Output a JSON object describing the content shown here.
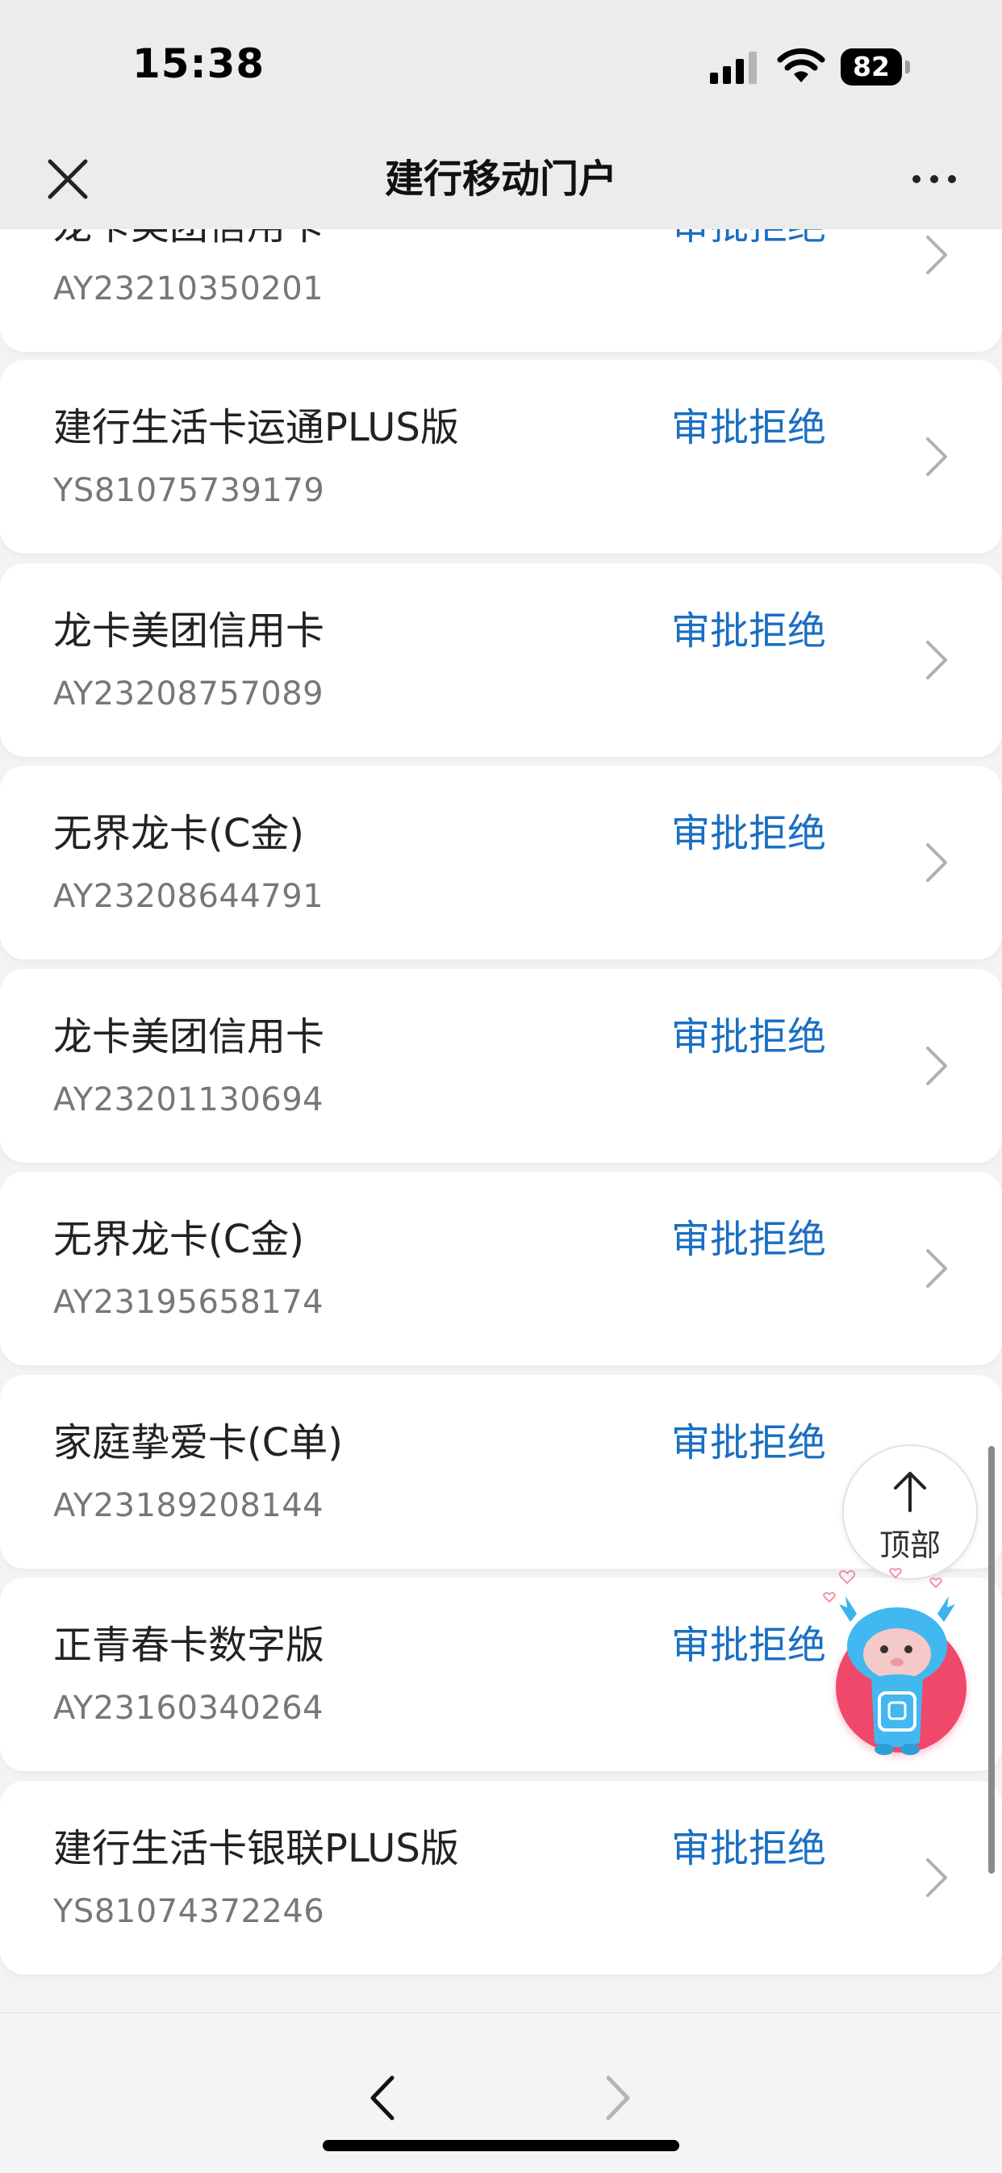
{
  "status_bar": {
    "time": "15:38",
    "battery": "82"
  },
  "nav": {
    "title": "建行移动门户"
  },
  "applications": [
    {
      "name": "龙卡美团信用卡",
      "number": "AY23210350201",
      "status": "审批拒绝"
    },
    {
      "name": "建行生活卡运通PLUS版",
      "number": "YS81075739179",
      "status": "审批拒绝"
    },
    {
      "name": "龙卡美团信用卡",
      "number": "AY23208757089",
      "status": "审批拒绝"
    },
    {
      "name": "无界龙卡(C金)",
      "number": "AY23208644791",
      "status": "审批拒绝"
    },
    {
      "name": "龙卡美团信用卡",
      "number": "AY23201130694",
      "status": "审批拒绝"
    },
    {
      "name": "无界龙卡(C金)",
      "number": "AY23195658174",
      "status": "审批拒绝"
    },
    {
      "name": "家庭挚爱卡(C单)",
      "number": "AY23189208144",
      "status": "审批拒绝"
    },
    {
      "name": "正青春卡数字版",
      "number": "AY23160340264",
      "status": "审批拒绝"
    },
    {
      "name": "建行生活卡银联PLUS版",
      "number": "YS81074372246",
      "status": "审批拒绝"
    }
  ],
  "floating": {
    "top_label": "顶部"
  },
  "colors": {
    "accent": "#1a6fc2",
    "mascot_button": "#f0486a"
  }
}
